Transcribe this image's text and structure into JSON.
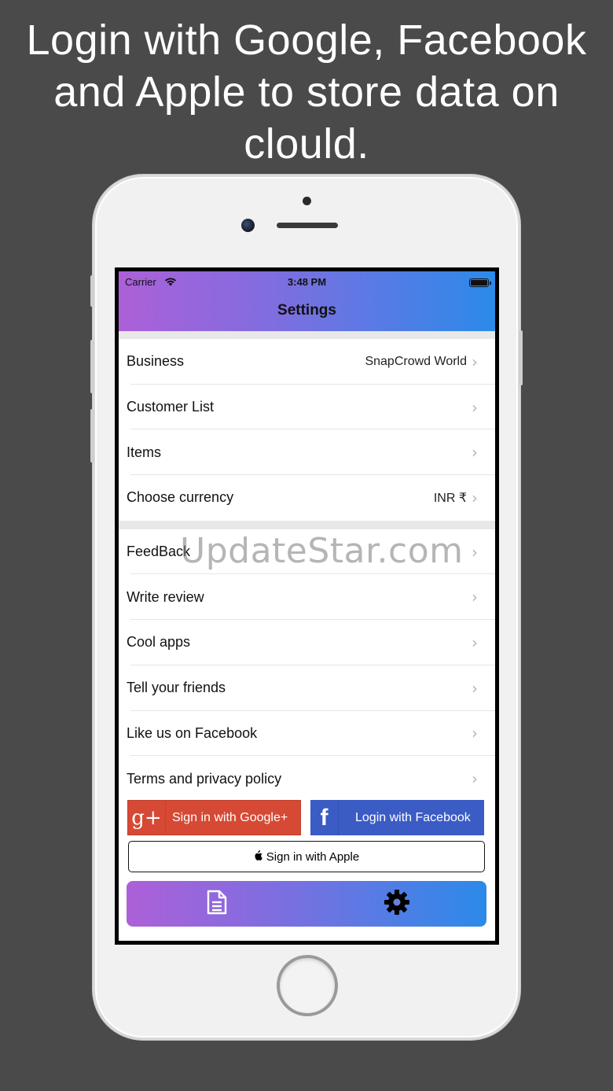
{
  "headline": {
    "line1": "Login with Google, Facebook",
    "line2": "and Apple to store data on",
    "line3": "clould."
  },
  "status_bar": {
    "carrier": "Carrier",
    "time": "3:48 PM",
    "wifi_icon": "wifi-icon",
    "battery_icon": "battery-icon"
  },
  "navbar": {
    "title": "Settings"
  },
  "settings": {
    "section1": [
      {
        "label": "Business",
        "value": "SnapCrowd World"
      },
      {
        "label": "Customer List",
        "value": ""
      },
      {
        "label": "Items",
        "value": ""
      },
      {
        "label": "Choose currency",
        "value": "INR ₹"
      }
    ],
    "section2": [
      {
        "label": "FeedBack"
      },
      {
        "label": "Write review"
      },
      {
        "label": "Cool apps"
      },
      {
        "label": "Tell your friends"
      },
      {
        "label": "Like us on Facebook"
      },
      {
        "label": "Terms and privacy policy"
      }
    ],
    "chevron": "›"
  },
  "watermark": "UpdateStar.com",
  "auth": {
    "google_label": "Sign in with Google+",
    "google_icon": "g+",
    "facebook_label": "Login with Facebook",
    "facebook_icon": "f",
    "apple_label": "Sign in with Apple"
  },
  "tabbar": {
    "tabs": [
      {
        "icon": "document-icon"
      },
      {
        "icon": "gear-icon"
      }
    ]
  },
  "colors": {
    "background": "#4a4a4a",
    "gradient_start": "#ad60d8",
    "gradient_end": "#2b8ae9",
    "google_red": "#d64934",
    "facebook_blue": "#3b5bc5"
  }
}
